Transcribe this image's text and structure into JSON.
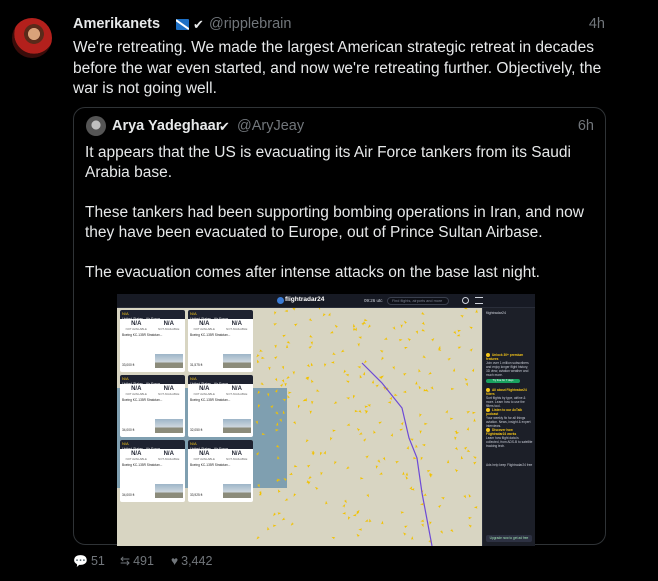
{
  "post": {
    "author_name": "Amerikanets",
    "author_handle": "@ripplebrain",
    "timestamp": "4h",
    "text": "We're retreating. We made the largest American strategic retreat in decades before the war even started, and now we're retreating further. Objectively, the war is not going well.",
    "flag_icon": "flag-icon",
    "verified_icon": "verified-badge-icon"
  },
  "quote": {
    "author_name": "Arya Yadeghaar",
    "author_handle": "@AryJeay",
    "timestamp": "6h",
    "paragraphs": [
      "It appears that the US is evacuating its Air Force tankers from its Saudi Arabia base.",
      "These tankers had been supporting bombing operations in Iran, and now they have been evacuated to Europe, out of Prince Sultan Airbase.",
      "The evacuation comes after intense attacks on the base last night."
    ],
    "screenshot": {
      "app_name": "flightradar24",
      "clock": "09:26 utc",
      "search_placeholder": "Find flights, airports and more",
      "cards": [
        {
          "id": "N/A",
          "operator": "United States - Air Force",
          "na_left": "N/A",
          "na_right": "N/A",
          "lbl_left": "NOT AVAILABLE",
          "lbl_right": "NOT AVAILABLE",
          "aircraft": "Boeing KC-135R Stratotan...",
          "alt": "33,000 ft"
        },
        {
          "id": "N/A",
          "operator": "United States - Air Force",
          "na_left": "N/A",
          "na_right": "N/A",
          "lbl_left": "NOT AVAILABLE",
          "lbl_right": "NOT AVAILABLE",
          "aircraft": "Boeing KC-135R Stratotan...",
          "alt": "31,575 ft"
        },
        {
          "id": "N/A",
          "operator": "United States - Air Force",
          "na_left": "N/A",
          "na_right": "N/A",
          "lbl_left": "NOT AVAILABLE",
          "lbl_right": "NOT AVAILABLE",
          "aircraft": "Boeing KC-135R Stratotan...",
          "alt": "34,000 ft"
        },
        {
          "id": "N/A",
          "operator": "United States - Air Force",
          "na_left": "N/A",
          "na_right": "N/A",
          "lbl_left": "NOT AVAILABLE",
          "lbl_right": "NOT AVAILABLE",
          "aircraft": "Boeing KC-135R Stratotan...",
          "alt": "32,050 ft"
        },
        {
          "id": "N/A",
          "operator": "United States - Air Force",
          "na_left": "N/A",
          "na_right": "N/A",
          "lbl_left": "NOT AVAILABLE",
          "lbl_right": "NOT AVAILABLE",
          "aircraft": "Boeing KC-135R Stratotan...",
          "alt": "34,000 ft"
        },
        {
          "id": "N/A",
          "operator": "United States - Air Force",
          "na_left": "N/A",
          "na_right": "N/A",
          "lbl_left": "NOT AVAILABLE",
          "lbl_right": "NOT AVAILABLE",
          "aircraft": "Boeing KC-135R Stratotan...",
          "alt": "33,925 ft"
        }
      ],
      "sidebar": {
        "header": "flightradar24",
        "items": [
          {
            "title": "Unlock 30+ premium features",
            "body": "Join over 1 million subscribers and enjoy longer flight history, 3D view, aviation weather and much more.",
            "button": "Try free for 7 days"
          },
          {
            "title": "All about Flightradar24 filters",
            "body": "Sort flights by type, airline & more. Learn how to use the filters tool."
          },
          {
            "title": "Listen to our AvTalk podcast",
            "body": "Your weekly fix for all things aviation. News, insight & expert interviews."
          },
          {
            "title": "Discover how Flightradar24 works",
            "body": "Learn how flight data is collected, from ADS-B to satellite tracking tech."
          },
          {
            "title": "Ads help keep Flightradar24 free",
            "body": ""
          }
        ],
        "upgrade": "Upgrade now to get ad free"
      }
    }
  },
  "actions": {
    "replies": "51",
    "reposts": "491",
    "likes": "3,442"
  },
  "colors": {
    "background": "#000000",
    "text": "#e7e9ea",
    "muted": "#71767b",
    "border": "#2f3336"
  }
}
